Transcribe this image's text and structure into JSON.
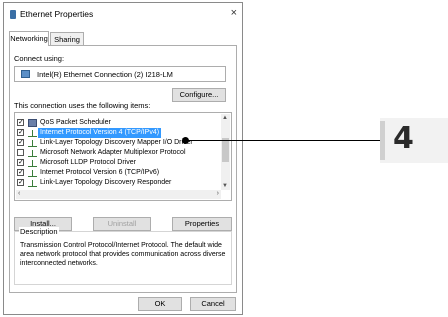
{
  "window": {
    "title": "Ethernet Properties",
    "close_glyph": "×"
  },
  "tabs": [
    {
      "label": "Networking"
    },
    {
      "label": "Sharing"
    }
  ],
  "connect_using": {
    "label": "Connect using:",
    "adapter": "Intel(R) Ethernet Connection (2) I218-LM"
  },
  "configure_button": "Configure...",
  "items_label": "This connection uses the following items:",
  "items": [
    {
      "label": "QoS Packet Scheduler",
      "checked": true,
      "icon": "scheduler-icon"
    },
    {
      "label": "Internet Protocol Version 4 (TCP/IPv4)",
      "checked": true,
      "selected": true,
      "icon": "network-protocol-icon"
    },
    {
      "label": "Link-Layer Topology Discovery Mapper I/O Driver",
      "checked": true,
      "icon": "network-protocol-icon"
    },
    {
      "label": "Microsoft Network Adapter Multiplexor Protocol",
      "checked": false,
      "icon": "network-protocol-icon"
    },
    {
      "label": "Microsoft LLDP Protocol Driver",
      "checked": true,
      "icon": "network-protocol-icon"
    },
    {
      "label": "Internet Protocol Version 6 (TCP/IPv6)",
      "checked": true,
      "icon": "network-protocol-icon"
    },
    {
      "label": "Link-Layer Topology Discovery Responder",
      "checked": true,
      "icon": "network-protocol-icon"
    }
  ],
  "buttons": {
    "install": "Install...",
    "uninstall": "Uninstall",
    "properties": "Properties",
    "ok": "OK",
    "cancel": "Cancel"
  },
  "description": {
    "legend": "Description",
    "text": "Transmission Control Protocol/Internet Protocol. The default wide area network protocol that provides communication across diverse interconnected networks."
  },
  "callout": {
    "number": "4"
  },
  "colors": {
    "selection": "#3399ff",
    "button_face": "#e1e1e1",
    "border": "#adadad"
  }
}
